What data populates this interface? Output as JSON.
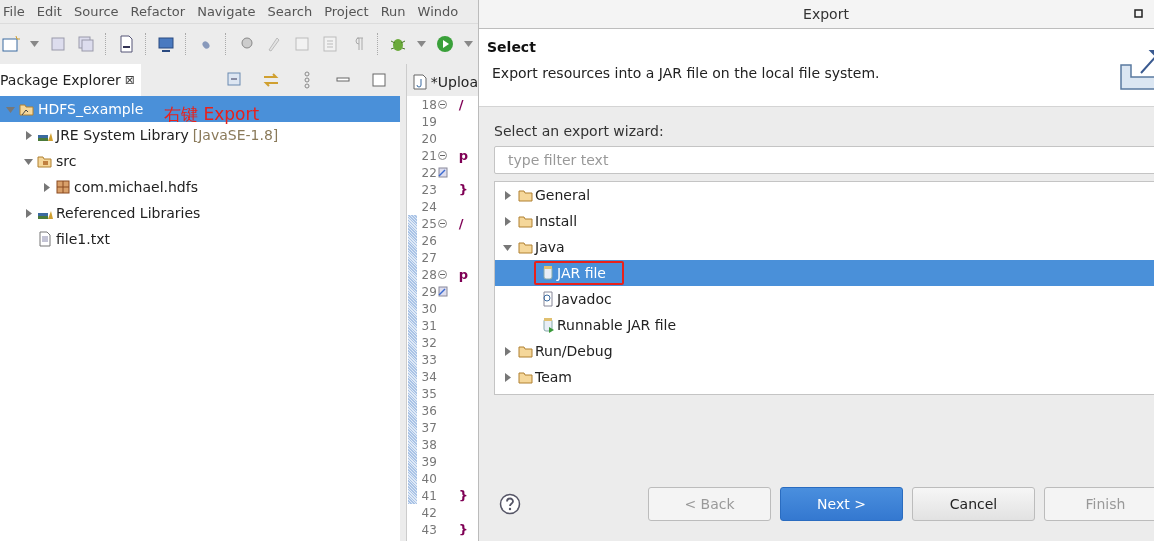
{
  "menu": [
    "File",
    "Edit",
    "Source",
    "Refactor",
    "Navigate",
    "Search",
    "Project",
    "Run",
    "Windo"
  ],
  "explorer": {
    "tab": "Package Explorer",
    "close": "⊠",
    "annotation": "右键 Export",
    "tree": [
      {
        "label": "HDFS_example",
        "kind": "project",
        "expanded": true,
        "selected": true,
        "children": [
          {
            "label": "JRE System Library",
            "suffix": "[JavaSE-1.8]",
            "kind": "library",
            "expanded": false,
            "selected": false
          },
          {
            "label": "src",
            "kind": "source-folder",
            "expanded": true,
            "selected": false,
            "children": [
              {
                "label": "com.michael.hdfs",
                "kind": "package",
                "expanded": false,
                "selected": false
              }
            ]
          },
          {
            "label": "Referenced Libraries",
            "kind": "library",
            "expanded": false,
            "selected": false
          },
          {
            "label": "file1.txt",
            "kind": "file",
            "selected": false
          }
        ]
      }
    ]
  },
  "editor": {
    "tab": "*Uploa",
    "lines": [
      {
        "number": "18",
        "code": "/",
        "folded": true,
        "changed": false
      },
      {
        "number": "19",
        "changed": false
      },
      {
        "number": "20",
        "changed": false
      },
      {
        "number": "21",
        "code": "p",
        "folded": true,
        "changed": false
      },
      {
        "number": "22",
        "marker": true,
        "changed": false
      },
      {
        "number": "23",
        "code": "}",
        "changed": false
      },
      {
        "number": "24",
        "changed": false
      },
      {
        "number": "25",
        "code": "/",
        "folded": true,
        "changed": true
      },
      {
        "number": "26",
        "changed": true
      },
      {
        "number": "27",
        "changed": true
      },
      {
        "number": "28",
        "code": "p",
        "folded": true,
        "changed": true
      },
      {
        "number": "29",
        "marker": true,
        "changed": true
      },
      {
        "number": "30",
        "changed": true
      },
      {
        "number": "31",
        "changed": true
      },
      {
        "number": "32",
        "changed": true
      },
      {
        "number": "33",
        "changed": true
      },
      {
        "number": "34",
        "changed": true
      },
      {
        "number": "35",
        "changed": true
      },
      {
        "number": "36",
        "changed": true
      },
      {
        "number": "37",
        "changed": true
      },
      {
        "number": "38",
        "changed": true
      },
      {
        "number": "39",
        "changed": true
      },
      {
        "number": "40",
        "changed": true
      },
      {
        "number": "41",
        "code": "}",
        "changed": true
      },
      {
        "number": "42",
        "changed": false
      },
      {
        "number": "43",
        "code": "}",
        "changed": false
      }
    ]
  },
  "dialog": {
    "title": "Export",
    "heading": "Select",
    "description": "Export resources into a JAR file on the local file system.",
    "prompt": "Select an export wizard:",
    "filter": {
      "placeholder": "type filter text"
    },
    "tree": [
      {
        "label": "General",
        "kind": "folder",
        "expanded": false,
        "selected": false,
        "marked": false
      },
      {
        "label": "Install",
        "kind": "folder",
        "expanded": false,
        "selected": false,
        "marked": false
      },
      {
        "label": "Java",
        "kind": "folder",
        "expanded": true,
        "selected": false,
        "marked": false,
        "children": [
          {
            "label": "JAR file",
            "kind": "jar",
            "selected": true,
            "marked": true
          },
          {
            "label": "Javadoc",
            "kind": "javadoc",
            "selected": false,
            "marked": false
          },
          {
            "label": "Runnable JAR file",
            "kind": "runnable-jar",
            "selected": false,
            "marked": false
          }
        ]
      },
      {
        "label": "Run/Debug",
        "kind": "folder",
        "expanded": false,
        "selected": false,
        "marked": false
      },
      {
        "label": "Team",
        "kind": "folder",
        "expanded": false,
        "selected": false,
        "marked": false
      }
    ],
    "buttons": [
      {
        "label": "< Back",
        "disabled": true,
        "primary": false
      },
      {
        "label": "Next >",
        "disabled": false,
        "primary": true
      },
      {
        "label": "Cancel",
        "disabled": false,
        "primary": false
      },
      {
        "label": "Finish",
        "disabled": true,
        "primary": false
      }
    ]
  }
}
